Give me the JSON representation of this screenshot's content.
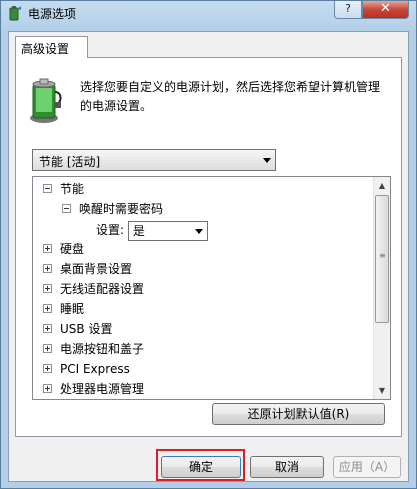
{
  "window": {
    "title": "电源选项",
    "help_label": "?",
    "close_label": "✕"
  },
  "tab": {
    "label": "高级设置"
  },
  "description": "选择您要自定义的电源计划，然后选择您希望计算机管理的电源设置。",
  "plan_select": {
    "value": "节能 [活动]"
  },
  "tree": {
    "items": [
      {
        "label": "节能",
        "state": "expanded",
        "level": 0
      },
      {
        "label": "唤醒时需要密码",
        "state": "expanded",
        "level": 1
      },
      {
        "label": "设置:",
        "value": "是",
        "level": 2
      },
      {
        "label": "硬盘",
        "state": "collapsed",
        "level": 0
      },
      {
        "label": "桌面背景设置",
        "state": "collapsed",
        "level": 0
      },
      {
        "label": "无线适配器设置",
        "state": "collapsed",
        "level": 0
      },
      {
        "label": "睡眠",
        "state": "collapsed",
        "level": 0
      },
      {
        "label": "USB 设置",
        "state": "collapsed",
        "level": 0
      },
      {
        "label": "电源按钮和盖子",
        "state": "collapsed",
        "level": 0
      },
      {
        "label": "PCI Express",
        "state": "collapsed",
        "level": 0
      },
      {
        "label": "处理器电源管理",
        "state": "collapsed",
        "level": 0
      }
    ]
  },
  "buttons": {
    "restore": "还原计划默认值(R)",
    "ok": "确定",
    "cancel": "取消",
    "apply": "应用（A）"
  },
  "icons": [
    "power-options-icon",
    "battery-icon",
    "help-icon",
    "close-icon",
    "chevron-down-icon",
    "scroll-up-icon",
    "scroll-down-icon"
  ],
  "colors": {
    "highlight_box": "#e21c23",
    "window_frame": "#b3cfe8"
  }
}
